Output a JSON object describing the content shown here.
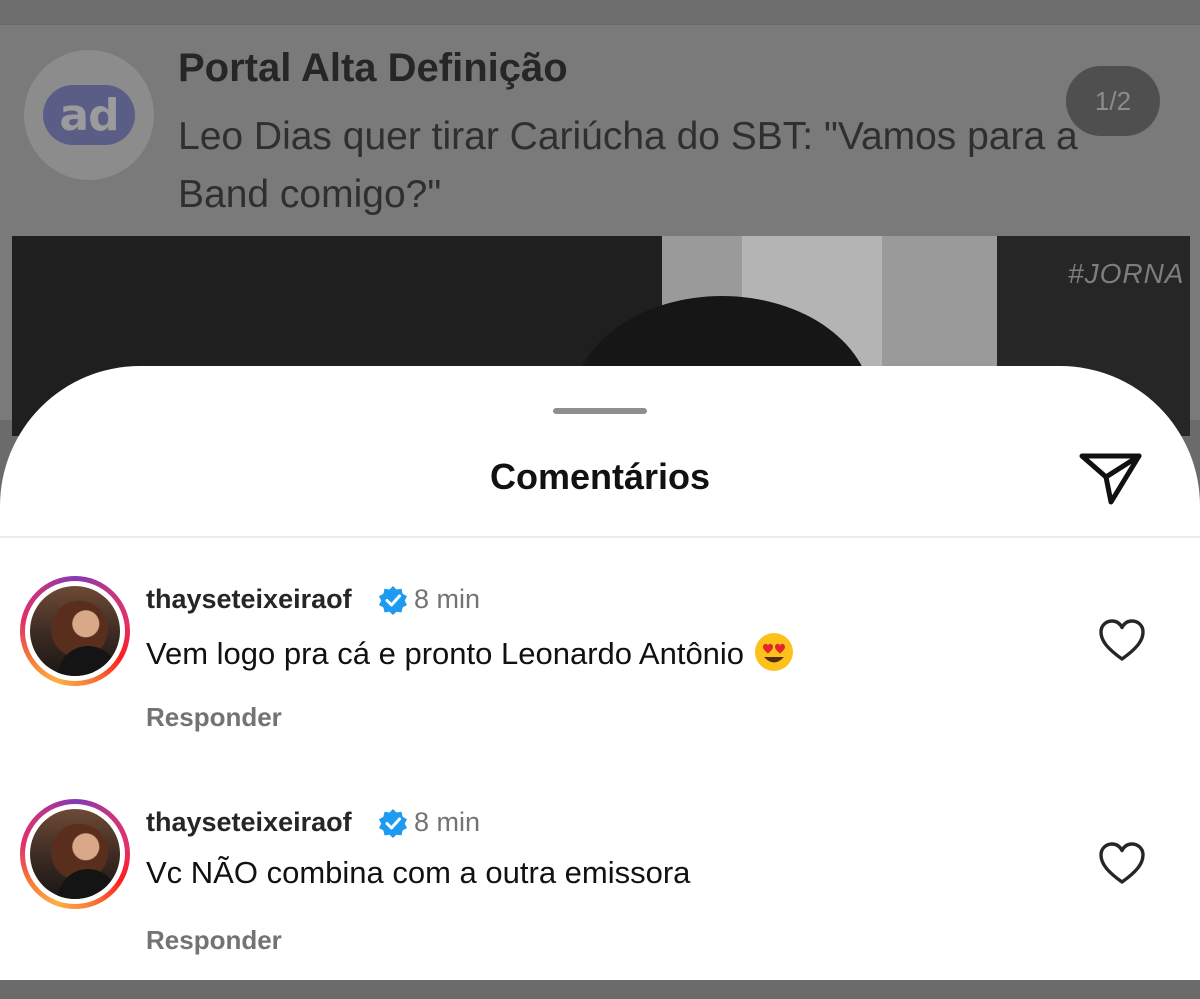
{
  "background_post": {
    "avatar_logo": "ad",
    "source_name": "Portal Alta Definição",
    "headline": "Leo Dias quer tirar Cariúcha do SBT: \"Vamos para a Band comigo?\"",
    "pager": "1/2",
    "image_watermark": "#JORNA"
  },
  "sheet": {
    "title": "Comentários",
    "share_icon": "paper-plane-icon"
  },
  "comments": [
    {
      "username": "thayseteixeiraof",
      "verified": true,
      "time": "8 min",
      "text": "Vem logo pra cá e pronto Leonardo Antônio",
      "emoji": "heart-eyes-emoji",
      "reply_label": "Responder",
      "like_icon": "heart-outline-icon"
    },
    {
      "username": "thayseteixeiraof",
      "verified": true,
      "time": "8 min",
      "text": "Vc NÃO combina com a outra emissora",
      "reply_label": "Responder",
      "like_icon": "heart-outline-icon"
    }
  ],
  "colors": {
    "verified_blue": "#1d9bf0",
    "dim_overlay": "#7a7a7a",
    "sheet_bg": "#ffffff",
    "secondary_text": "#737373"
  }
}
